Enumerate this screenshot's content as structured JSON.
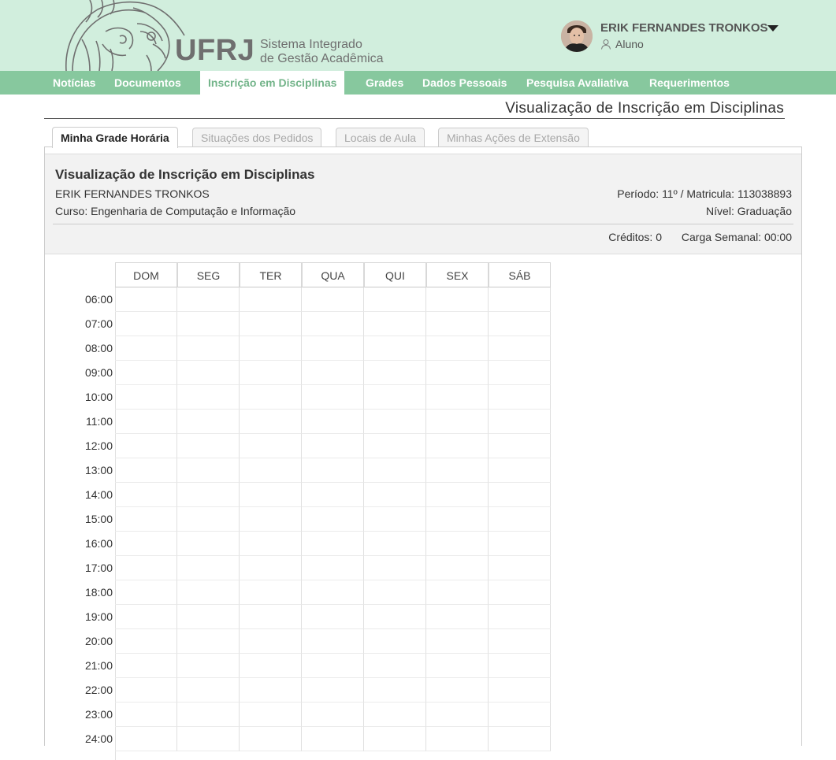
{
  "header": {
    "logo_text": "UFRJ",
    "logo_sub_line1": "Sistema Integrado",
    "logo_sub_line2": "de Gestão Acadêmica",
    "user_name": "ERIK FERNANDES TRONKOS",
    "user_role": "Aluno"
  },
  "nav": {
    "items": [
      {
        "label": "Notícias"
      },
      {
        "label": "Documentos"
      },
      {
        "label": "Inscrição em Disciplinas"
      },
      {
        "label": "Grades"
      },
      {
        "label": "Dados Pessoais"
      },
      {
        "label": "Pesquisa Avaliativa"
      },
      {
        "label": "Requerimentos"
      }
    ],
    "active_index": 2
  },
  "page": {
    "title": "Visualização de Inscrição em Disciplinas"
  },
  "tabs": [
    {
      "label": "Minha Grade Horária"
    },
    {
      "label": "Situações dos Pedidos"
    },
    {
      "label": "Locais de Aula"
    },
    {
      "label": "Minhas Ações de Extensão"
    }
  ],
  "info": {
    "title": "Visualização de Inscrição em Disciplinas",
    "student_name": "ERIK FERNANDES TRONKOS",
    "course": "Curso: Engenharia de Computação e Informação",
    "period": "Período: 11º / Matricula: 113038893",
    "level": "Nível: Graduação",
    "credits": "Créditos: 0",
    "weekly_load": "Carga Semanal: 00:00"
  },
  "schedule": {
    "days": [
      "DOM",
      "SEG",
      "TER",
      "QUA",
      "QUI",
      "SEX",
      "SÁB"
    ],
    "hours": [
      "06:00",
      "07:00",
      "08:00",
      "09:00",
      "10:00",
      "11:00",
      "12:00",
      "13:00",
      "14:00",
      "15:00",
      "16:00",
      "17:00",
      "18:00",
      "19:00",
      "20:00",
      "21:00",
      "22:00",
      "23:00",
      "24:00"
    ]
  },
  "colors": {
    "header_bg": "#d1eedd",
    "nav_bg": "#87c89e",
    "nav_active_text": "#73b48a"
  }
}
